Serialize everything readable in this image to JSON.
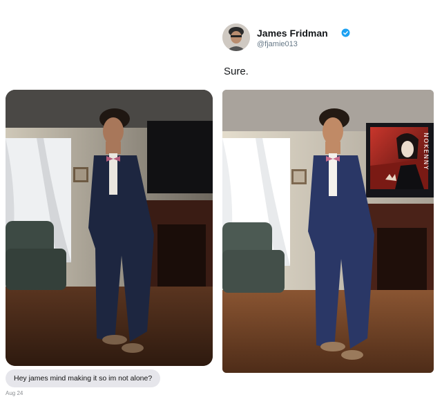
{
  "tweet": {
    "display_name": "James Fridman",
    "handle": "@fjamie013",
    "verified": true,
    "text": "Sure."
  },
  "message": {
    "text": "Hey james mind making it so im not alone?",
    "date": "Aug 24"
  },
  "edited_photo": {
    "tv_watermark": "NOKENNY"
  },
  "colors": {
    "verified_blue": "#1da1f2",
    "bubble_bg": "#e6e6eb",
    "handle_gray": "#657786"
  }
}
